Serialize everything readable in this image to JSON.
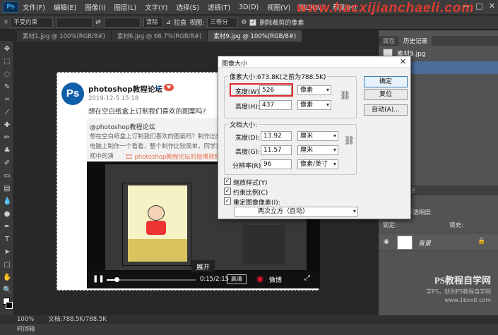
{
  "menubar": {
    "logo": "Ps",
    "items": [
      "文件(F)",
      "编辑(E)",
      "图像(I)",
      "图层(L)",
      "文字(Y)",
      "选择(S)",
      "滤镜(T)",
      "3D(D)",
      "视图(V)",
      "窗口(W)",
      "帮助(H)"
    ],
    "watermark": "www.hacxijianchaeli.com",
    "win_buttons": [
      "—",
      "□",
      "✕"
    ]
  },
  "options": {
    "ratio_select": "不受约束",
    "swap_symbol": "⇄",
    "clear_label": "清除",
    "straighten_label": "拉直",
    "view_label": "视图:",
    "view_select": "三等分",
    "delete_label": "删除裁剪的像素"
  },
  "tabs": [
    "素材1.jpg @ 100%(RGB/8#)",
    "素材6.jpg @ 66.7%(RGB/8#)",
    "素材9.jpg @ 100%(RGB/8#)"
  ],
  "post": {
    "avatar": "Ps",
    "name": "photoshop教程论坛",
    "verified": "V",
    "vip": "♥",
    "date": "2019-12-5 15:18",
    "text": "想在空白纸盒上订制我们喜欢的图案吗?",
    "quote_name": "@photoshop教程论坛",
    "quote_lines": [
      "想在空白纸盒上订制我们喜欢的图案吗？制作出来是什么效果",
      "电脑上制作一个看看，整个制作比较简单，同学只要跟着教程",
      "视中的演"
    ],
    "quote_link": "🎞 photoshop教程论坛的微博视频",
    "expand_label": "展开",
    "time": "0:15/2:15",
    "hd_label": "高清",
    "weibo_label": "微博",
    "progress_fraction": 0.11
  },
  "dialog": {
    "title": "图像大小",
    "pixel_group": "像素大小:673.8K(之前为788.5K)",
    "width_label": "宽度(W):",
    "width_value": "526",
    "height_label": "高度(H):",
    "height_value": "437",
    "px_unit": "像素",
    "doc_group": "文档大小:",
    "doc_width_label": "宽度(D):",
    "doc_width_value": "13.92",
    "doc_height_label": "高度(G):",
    "doc_height_value": "11.57",
    "cm_unit": "厘米",
    "res_label": "分辨率(R):",
    "res_value": "96",
    "res_unit": "像素/英寸",
    "scale_styles": "缩放样式(Y)",
    "constrain": "约束比例(C)",
    "resample": "重定图像像素(I):",
    "resample_method": "两次立方（自动）",
    "ok_label": "确定",
    "reset_label": "复位",
    "auto_label": "自动(A)...",
    "check": "✓",
    "close": "✕"
  },
  "right": {
    "top_tabs": [
      "属性",
      "历史记录"
    ],
    "history_file": "素材9.jpg",
    "history_item": "打开",
    "layer_tabs": [
      "通道",
      "路径"
    ],
    "opacity_label": "不透明度:",
    "fill_label": "填充:",
    "lock_label": "锁定:",
    "layer_name": "背景",
    "watermark_big": "PS教程自学网",
    "watermark_small1": "学PS，就到PS教程自学网",
    "watermark_small2": "www.16xx8.com"
  },
  "status": {
    "zoom": "100%",
    "doc": "文档:788.5K/788.5K",
    "timeline": "时间轴"
  }
}
